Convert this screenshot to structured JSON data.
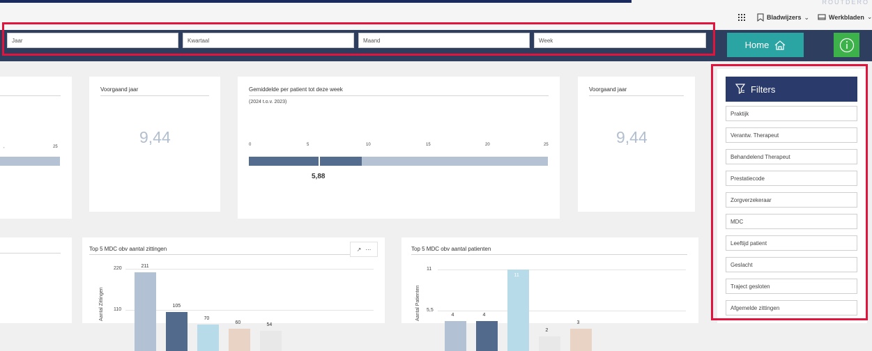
{
  "corner_text": "ROUTDERO",
  "toolbar": {
    "bookmarks_label": "Bladwijzers",
    "worksheets_label": "Werkbladen"
  },
  "slicers": {
    "year": "Jaar",
    "quarter": "Kwartaal",
    "month": "Maand",
    "week": "Week"
  },
  "home_label": "Home",
  "kpi": {
    "left_tick": "25",
    "prev_year_title": "Voorgaand jaar",
    "prev_year_value": "9,44",
    "avg_title": "Gemiddelde per patient tot deze week",
    "avg_subtitle": "(2024 t.o.v. 2023)",
    "avg_ticks": [
      "0",
      "5",
      "10",
      "15",
      "20",
      "25"
    ],
    "avg_value": "5,88",
    "prev_year_title2": "Voorgaand jaar",
    "prev_year_value2": "9,44"
  },
  "filters": {
    "title": "Filters",
    "items": [
      "Praktijk",
      "Verantw. Therapeut",
      "Behandelend Therapeut",
      "Prestatiecode",
      "Zorgverzekeraar",
      "MDC",
      "Leeftijd patient",
      "Geslacht",
      "Traject gesloten",
      "Afgemelde zittingen"
    ]
  },
  "chart_data": [
    {
      "type": "bar",
      "title": "Top 5 MDC obv aantal zittingen",
      "ylabel": "Aantal Zittingen",
      "yticks": [
        "220",
        "110"
      ],
      "values": [
        211,
        105,
        70,
        60,
        54
      ],
      "colors": [
        "#b2c1d3",
        "#526a8c",
        "#b8dbe9",
        "#e8d3c4",
        "#e8e8e8"
      ]
    },
    {
      "type": "bar",
      "title": "Top 5 MDC obv aantal patienten",
      "ylabel": "Aantal Patienten",
      "yticks": [
        "11",
        "5,5"
      ],
      "values": [
        4,
        4,
        11,
        2,
        3
      ],
      "colors": [
        "#b2c1d3",
        "#526a8c",
        "#b8dbe9",
        "#e8e8e8",
        "#e8d3c4"
      ]
    }
  ]
}
